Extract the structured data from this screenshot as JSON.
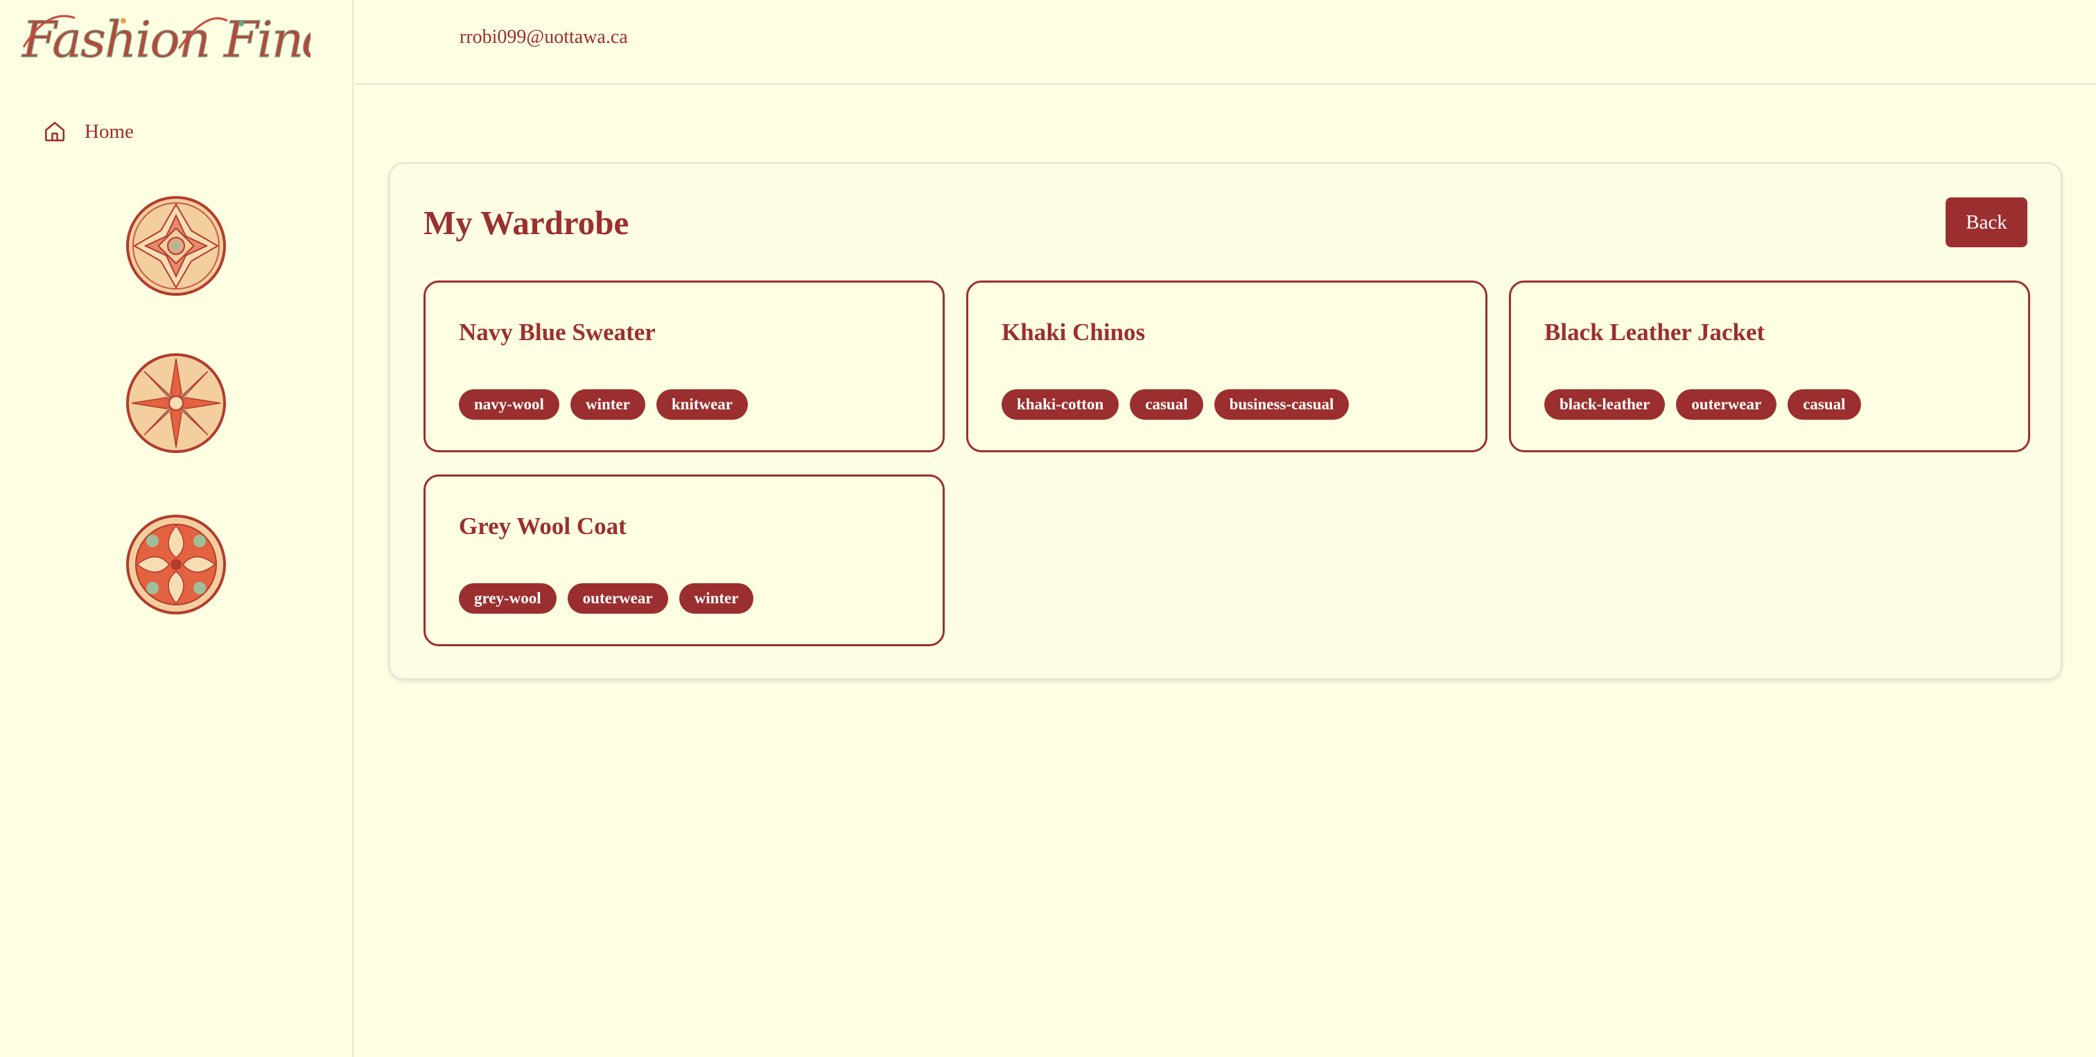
{
  "brand": {
    "logo_text": "Fashion Finders",
    "logo_icon": "fashion-finders-logo"
  },
  "sidebar": {
    "home": {
      "label": "Home",
      "icon": "home-icon"
    },
    "medallions": [
      "medallion-icon",
      "medallion-icon",
      "medallion-icon"
    ]
  },
  "header": {
    "user_email": "rrobi099@uottawa.ca"
  },
  "wardrobe": {
    "title": "My Wardrobe",
    "back_label": "Back",
    "items": [
      {
        "name": "Navy Blue Sweater",
        "tags": [
          "navy-wool",
          "winter",
          "knitwear"
        ]
      },
      {
        "name": "Khaki Chinos",
        "tags": [
          "khaki-cotton",
          "casual",
          "business-casual"
        ]
      },
      {
        "name": "Black Leather Jacket",
        "tags": [
          "black-leather",
          "outerwear",
          "casual"
        ]
      },
      {
        "name": "Grey Wool Coat",
        "tags": [
          "grey-wool",
          "outerwear",
          "winter"
        ]
      }
    ]
  },
  "colors": {
    "background": "#fefee2",
    "accent": "#9b2f2f",
    "border": "#e6e6d2",
    "tag_text": "#ffffff"
  }
}
